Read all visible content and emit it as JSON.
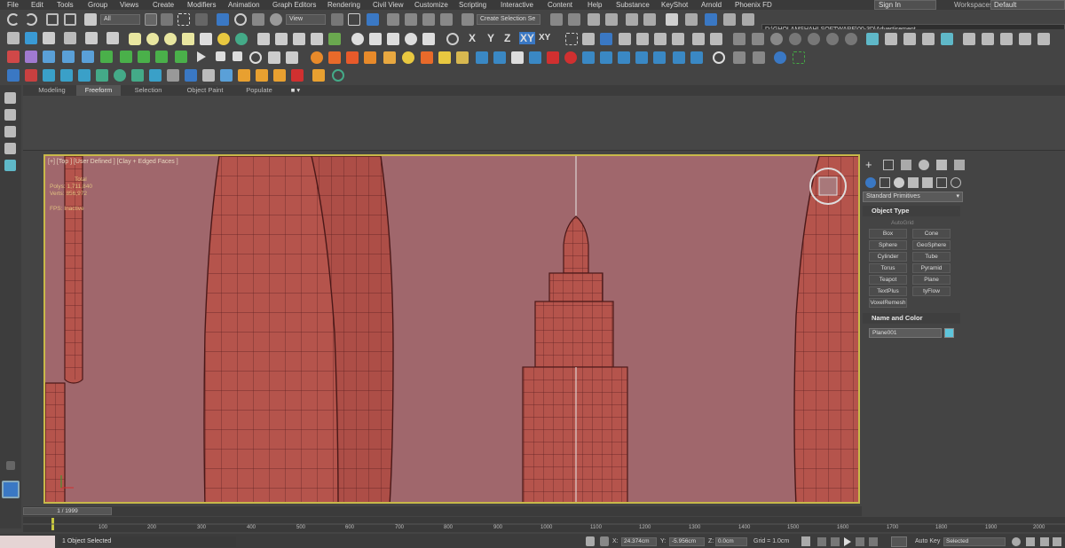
{
  "menu": [
    "File",
    "Edit",
    "Tools",
    "Group",
    "Views",
    "Create",
    "Modifiers",
    "Animation",
    "Graph Editors",
    "Rendering",
    "Civil View",
    "Customize",
    "Scripting",
    "Interactive",
    "Content",
    "Help",
    "Substance",
    "KeyShot",
    "Arnold",
    "Phoenix FD"
  ],
  "account": {
    "signin_label": "Sign In",
    "workspaces_label": "Workspaces:",
    "workspace_value": "Default"
  },
  "toolbar": {
    "filter_value": "All",
    "ref_coord_value": "View",
    "selection_set_placeholder": "Create Selection Se",
    "project_path": "D:\\GHOLAMSHAHI SOFTWARE\\00-3D\\Advertisement",
    "axis_x": "X",
    "axis_y": "Y",
    "axis_z": "Z",
    "axis_xy": "XY",
    "axis_xy2": "XY"
  },
  "ribbon": {
    "tabs": [
      "Modeling",
      "Freeform",
      "Selection",
      "Object Paint",
      "Populate"
    ],
    "active_tab": "Freeform"
  },
  "viewport": {
    "label": "[+] [Top ] [User Defined ] [Clay + Edged Faces ]",
    "stats": {
      "total_label": "Total",
      "polys_label": "Polys:",
      "polys_value": "1,711,840",
      "verts_label": "Verts:",
      "verts_value": "856,972",
      "fps_label": "FPS:",
      "fps_value": "Inactive"
    },
    "background_color": "#a0676c",
    "model_color": "#b5544c"
  },
  "command_panel": {
    "category_value": "Standard Primitives",
    "object_type_header": "Object Type",
    "autogrid_label": "AutoGrid",
    "primitives": [
      "Box",
      "Cone",
      "Sphere",
      "GeoSphere",
      "Cylinder",
      "Tube",
      "Torus",
      "Pyramid",
      "Teapot",
      "Plane",
      "TextPlus",
      "tyFlow",
      "VoxelRemesh"
    ],
    "name_color_header": "Name and Color",
    "object_name": "Plane001",
    "object_color": "#5ec6dc"
  },
  "timeline": {
    "frame_display": "1 / 1999",
    "ticks": [
      "100",
      "200",
      "300",
      "400",
      "500",
      "600",
      "700",
      "800",
      "900",
      "1000",
      "1100",
      "1200",
      "1300",
      "1400",
      "1500",
      "1600",
      "1700",
      "1800",
      "1900",
      "2000"
    ]
  },
  "status": {
    "selection_text": "1 Object Selected",
    "x_label": "X:",
    "x_value": "24.374cm",
    "y_label": "Y:",
    "y_value": "-5.956cm",
    "z_label": "Z:",
    "z_value": "0.0cm",
    "grid_text": "Grid = 1.0cm",
    "autokey_label": "Auto Key",
    "key_filter_value": "Selected"
  }
}
